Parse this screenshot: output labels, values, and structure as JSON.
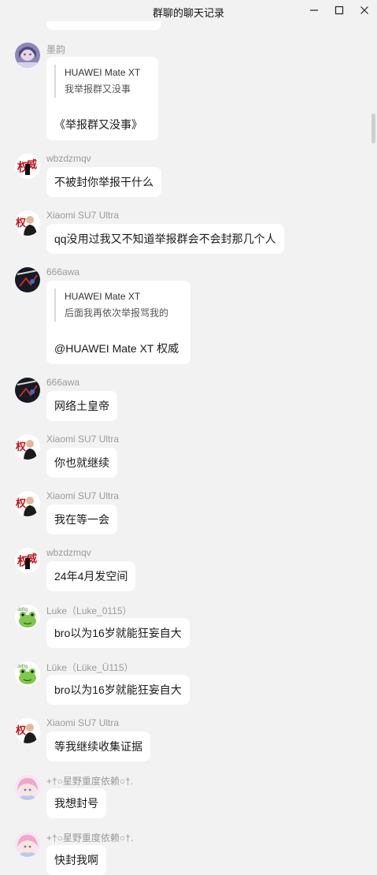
{
  "window": {
    "title": "群聊的聊天记录"
  },
  "messages": [
    {
      "name": "墨韵",
      "quote_name": "HUAWEI Mate XT",
      "quote_text": "我举报群又没事",
      "text": "《举报群又没事》",
      "avatar": "anime-girl-avatar"
    },
    {
      "name": "wbzdzmqv",
      "text": "不被封你举报干什么",
      "avatar": "authority-stamp-avatar"
    },
    {
      "name": "Xiaomi SU7 Ultra",
      "text": "qq没用过我又不知道举报群会不会封那几个人",
      "avatar": "man-authority-avatar"
    },
    {
      "name": "666awa",
      "quote_name": "HUAWEI Mate XT",
      "quote_text": "后面我再依次举报骂我的",
      "text": "@HUAWEI Mate XT 权威",
      "avatar": "dark-game-avatar"
    },
    {
      "name": "666awa",
      "text": "网络土皇帝",
      "avatar": "dark-game-avatar"
    },
    {
      "name": "Xiaomi SU7 Ultra",
      "text": "你也就继续",
      "avatar": "man-authority-avatar"
    },
    {
      "name": "Xiaomi SU7 Ultra",
      "text": "我在等一会",
      "avatar": "man-authority-avatar"
    },
    {
      "name": "wbzdzmqv",
      "text": "24年4月发空间",
      "avatar": "authority-stamp-avatar"
    },
    {
      "name": "Luke（Luke_0115）",
      "text": "bro以为16岁就能狂妄自大",
      "avatar": "frog-avatar"
    },
    {
      "name": "Lüke（Lüke_Ü115）",
      "text": "bro以为16岁就能狂妄自大",
      "avatar": "frog-avatar"
    },
    {
      "name": "Xiaomi SU7 Ultra",
      "text": "等我继续收集证据",
      "avatar": "man-authority-avatar"
    },
    {
      "name": "+†○星野重度依赖○†.",
      "text": "我想封号",
      "avatar": "pink-anime-avatar"
    },
    {
      "name": "+†○星野重度依赖○†.",
      "text": "快封我啊",
      "avatar": "pink-anime-avatar"
    }
  ],
  "colors": {
    "background": "#f2f2f2",
    "bubble": "#ffffff",
    "name_text": "#9a9a9a",
    "message_text": "#1a1a1a"
  }
}
